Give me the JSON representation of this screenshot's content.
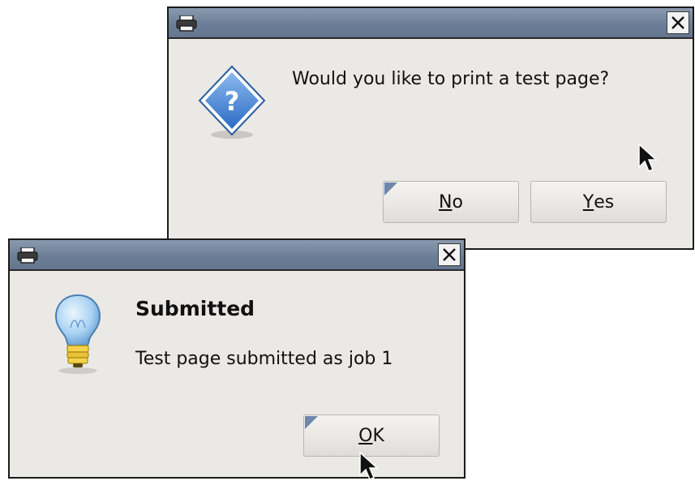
{
  "dialog_print_test": {
    "message": "Would you like to print a test page?",
    "no_mnemonic": "N",
    "no_rest": "o",
    "yes_mnemonic": "Y",
    "yes_rest": "es",
    "close_label": "✕"
  },
  "dialog_submitted": {
    "heading": "Submitted",
    "message": "Test page submitted as job 1",
    "ok_mnemonic": "O",
    "ok_rest": "K",
    "close_label": "✕"
  },
  "colors": {
    "titlebar": "#6d7f98",
    "dialog_bg": "#ebe9e6",
    "question_icon": "#3d7bd0",
    "bulb": "#a9d2f3"
  },
  "icons": {
    "window": "printer-icon",
    "question": "question-diamond-icon",
    "info": "lightbulb-icon",
    "pointer": "mouse-cursor-icon"
  }
}
